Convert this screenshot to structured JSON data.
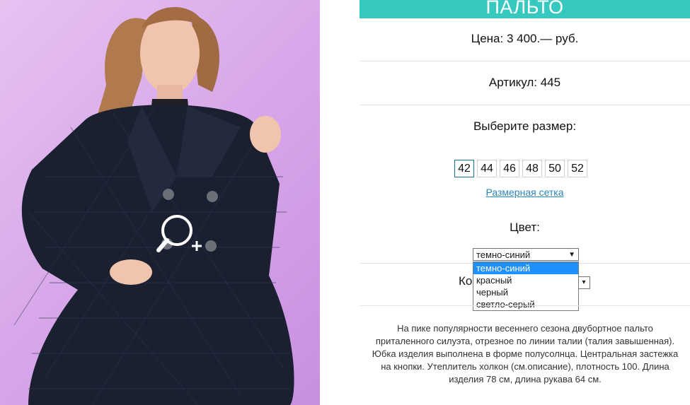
{
  "product": {
    "title": "ПАЛЬТО",
    "price": "Цена: 3 400.— руб.",
    "article": "Артикул: 445",
    "choose_size": "Выберите размер:",
    "sizes": [
      "42",
      "44",
      "46",
      "48",
      "50",
      "52"
    ],
    "selected_size": "42",
    "size_chart_link": "Размерная сетка",
    "color_label": "Цвет:",
    "color_selected": "темно-синий",
    "color_options": [
      "темно-синий",
      "красный",
      "черный",
      "светло-серый"
    ],
    "quantity_label_partial": "Ко",
    "description": "На пике популярности весеннего сезона двубортное пальто приталенного силуэта, отрезное по линии талии (талия завышенная). Юбка изделия выполнена в форме полусолнца. Центральная застежка на кнопки. Утеплитель холкон (см.описание), плотность 100. Длина изделия 78 см, длина рукава 64 см."
  },
  "icons": {
    "zoom": "zoom-in-icon",
    "dropdown_arrow": "chevron-down-icon"
  },
  "colors": {
    "title_bar": "#37c8bf",
    "photo_bg": "#d9a9ea",
    "link": "#2a86b8",
    "option_highlight": "#1e90ff"
  }
}
